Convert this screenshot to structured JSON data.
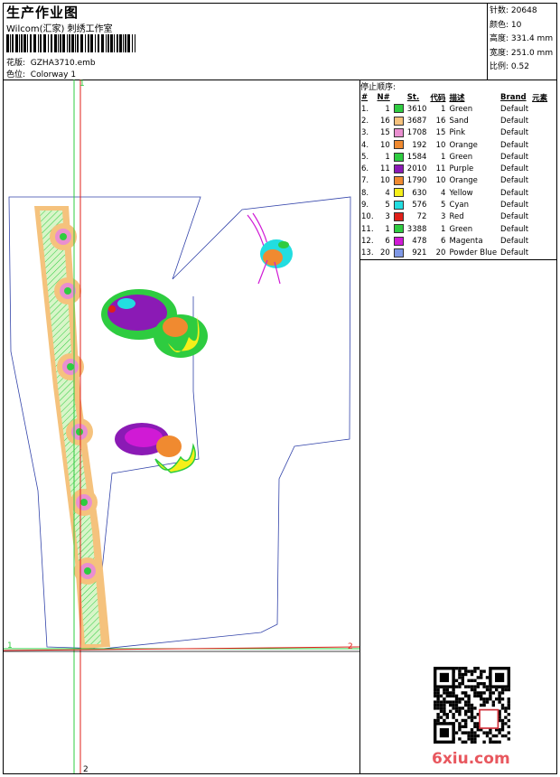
{
  "header": {
    "title": "生产作业图",
    "subtitle": "Wilcom(汇家) 刺绣工作室",
    "design_label": "花版:",
    "design_file": "GZHA3710.emb",
    "colorway_label": "色位:",
    "colorway": "Colorway 1"
  },
  "stats": [
    {
      "label": "针数:",
      "value": "20648"
    },
    {
      "label": "颜色:",
      "value": "10"
    },
    {
      "label": "高度:",
      "value": "331.4 mm"
    },
    {
      "label": "宽度:",
      "value": "251.0 mm"
    },
    {
      "label": "比例:",
      "value": "0.52"
    }
  ],
  "stop_sequence": {
    "heading": "停止顺序:",
    "columns": [
      "#",
      "N#",
      "St.",
      "代码",
      "描述",
      "Brand",
      "元素"
    ],
    "rows": [
      {
        "idx": "1.",
        "n": "1",
        "color": "#2ecc40",
        "st": "3610",
        "code": "1",
        "desc": "Green",
        "brand": "Default"
      },
      {
        "idx": "2.",
        "n": "16",
        "color": "#f5c27d",
        "st": "3687",
        "code": "16",
        "desc": "Sand",
        "brand": "Default"
      },
      {
        "idx": "3.",
        "n": "15",
        "color": "#e98fd0",
        "st": "1708",
        "code": "15",
        "desc": "Pink",
        "brand": "Default"
      },
      {
        "idx": "4.",
        "n": "10",
        "color": "#f08a30",
        "st": "192",
        "code": "10",
        "desc": "Orange",
        "brand": "Default"
      },
      {
        "idx": "5.",
        "n": "1",
        "color": "#2ecc40",
        "st": "1584",
        "code": "1",
        "desc": "Green",
        "brand": "Default"
      },
      {
        "idx": "6.",
        "n": "11",
        "color": "#8b1ab5",
        "st": "2010",
        "code": "11",
        "desc": "Purple",
        "brand": "Default"
      },
      {
        "idx": "7.",
        "n": "10",
        "color": "#f08a30",
        "st": "1790",
        "code": "10",
        "desc": "Orange",
        "brand": "Default"
      },
      {
        "idx": "8.",
        "n": "4",
        "color": "#f5ef1a",
        "st": "630",
        "code": "4",
        "desc": "Yellow",
        "brand": "Default"
      },
      {
        "idx": "9.",
        "n": "5",
        "color": "#22dde0",
        "st": "576",
        "code": "5",
        "desc": "Cyan",
        "brand": "Default"
      },
      {
        "idx": "10.",
        "n": "3",
        "color": "#e0201a",
        "st": "72",
        "code": "3",
        "desc": "Red",
        "brand": "Default"
      },
      {
        "idx": "11.",
        "n": "1",
        "color": "#2ecc40",
        "st": "3388",
        "code": "1",
        "desc": "Green",
        "brand": "Default"
      },
      {
        "idx": "12.",
        "n": "6",
        "color": "#d01ad5",
        "st": "478",
        "code": "6",
        "desc": "Magenta",
        "brand": "Default"
      },
      {
        "idx": "13.",
        "n": "20",
        "color": "#7f98e6",
        "st": "921",
        "code": "20",
        "desc": "Powder Blue",
        "brand": "Default"
      }
    ]
  },
  "markers": {
    "one": "1",
    "two": "2"
  },
  "watermark": "6xiu.com"
}
